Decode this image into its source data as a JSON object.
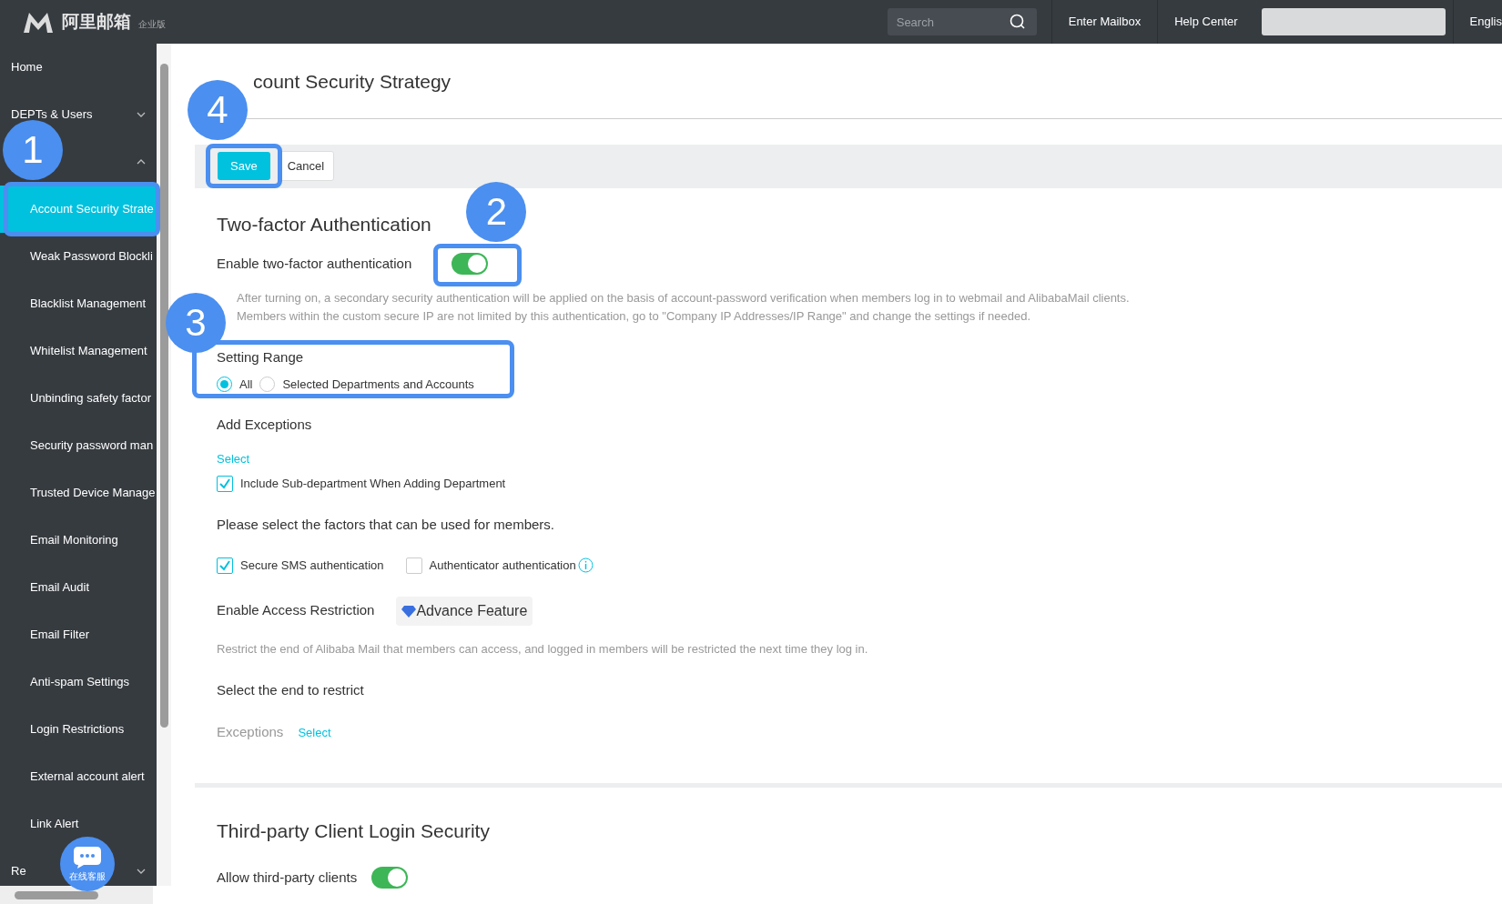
{
  "header": {
    "logo_text": "阿里邮箱",
    "edition": "企业版",
    "search": {
      "placeholder": "Search"
    },
    "links": [
      "Enter Mailbox",
      "Help Center"
    ],
    "language": "Englis"
  },
  "sidebar": {
    "items": [
      {
        "label": "Home",
        "kind": "top"
      },
      {
        "label": "DEPTs & Users",
        "kind": "group",
        "expanded": false
      },
      {
        "kind": "group",
        "expanded": true
      },
      {
        "label": "Account Security Strate",
        "kind": "sub",
        "selected": true
      },
      {
        "label": "Weak Password Blockli",
        "kind": "sub",
        "selected": false
      },
      {
        "label": "Blacklist Management",
        "kind": "sub",
        "selected": false
      },
      {
        "label": "Whitelist Management",
        "kind": "sub",
        "selected": false
      },
      {
        "label": "Unbinding safety factor",
        "kind": "sub",
        "selected": false
      },
      {
        "label": "Security password man",
        "kind": "sub",
        "selected": false
      },
      {
        "label": "Trusted Device Manage",
        "kind": "sub",
        "selected": false
      },
      {
        "label": "Email Monitoring",
        "kind": "sub",
        "selected": false
      },
      {
        "label": "Email Audit",
        "kind": "sub",
        "selected": false
      },
      {
        "label": "Email Filter",
        "kind": "sub",
        "selected": false
      },
      {
        "label": "Anti-spam Settings",
        "kind": "sub",
        "selected": false
      },
      {
        "label": "Login Restrictions",
        "kind": "sub",
        "selected": false
      },
      {
        "label": "External account alert",
        "kind": "sub",
        "selected": false
      },
      {
        "label": "Link Alert",
        "kind": "sub",
        "selected": false
      },
      {
        "label": "Re",
        "kind": "group",
        "expanded": false
      }
    ]
  },
  "page_title": "count Security Strategy",
  "buttons": [
    {
      "label": "Save",
      "kind": "primary"
    },
    {
      "label": "Cancel",
      "kind": "plain"
    }
  ],
  "two_factor": {
    "heading": "Two-factor Authentication",
    "toggle_label": "Enable two-factor authentication",
    "on": true,
    "description": [
      "After turning on, a secondary security authentication will be applied on the basis of account-password verification when members log in to webmail and AlibabaMail clients.",
      "Members within the custom secure IP are not limited by this authentication, go to \"Company IP Addresses/IP Range\" and change the settings if needed."
    ],
    "setting_range": {
      "label": "Setting Range",
      "options": [
        {
          "label": "All",
          "selected": true
        },
        {
          "label": "Selected Departments and Accounts",
          "selected": false
        }
      ]
    },
    "exceptions": {
      "label": "Add Exceptions",
      "link": "Select",
      "checkbox": {
        "label": "Include Sub-department When Adding Department",
        "checked": true
      }
    },
    "factors": {
      "label": "Please select the factors that can be used for members.",
      "options": [
        {
          "label": "Secure SMS authentication",
          "checked": true,
          "info": false
        },
        {
          "label": "Authenticator authentication",
          "checked": false,
          "info": true
        }
      ]
    }
  },
  "access_restriction": {
    "label": "Enable Access Restriction",
    "badge": "Advance Feature",
    "description": "Restrict the end of Alibaba Mail that members can access, and logged in members will be restricted the next time they log in.",
    "select_label": "Select the end to restrict",
    "exceptions_label": "Exceptions",
    "exceptions_link": "Select"
  },
  "third_party": {
    "heading": "Third-party Client Login Security",
    "toggle_label": "Allow third-party clients",
    "on": true
  },
  "chat_widget": {
    "label": "在线客服"
  },
  "callouts": [
    {
      "number": "1"
    },
    {
      "number": "2"
    },
    {
      "number": "3"
    },
    {
      "number": "4"
    }
  ]
}
